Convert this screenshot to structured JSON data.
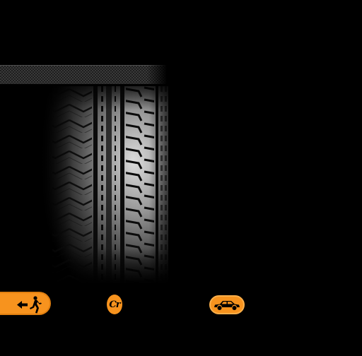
{
  "scene": {
    "background_color": "#000000",
    "banner_label": ""
  },
  "bottom_bar": {
    "exit": {
      "icon": "exit-running-person-icon",
      "color": "#f7931e"
    },
    "credits": {
      "label": "Cr",
      "icon": "credits-icon",
      "color": "#f7931e"
    },
    "car": {
      "icon": "car-icon",
      "color": "#f7931e"
    }
  }
}
